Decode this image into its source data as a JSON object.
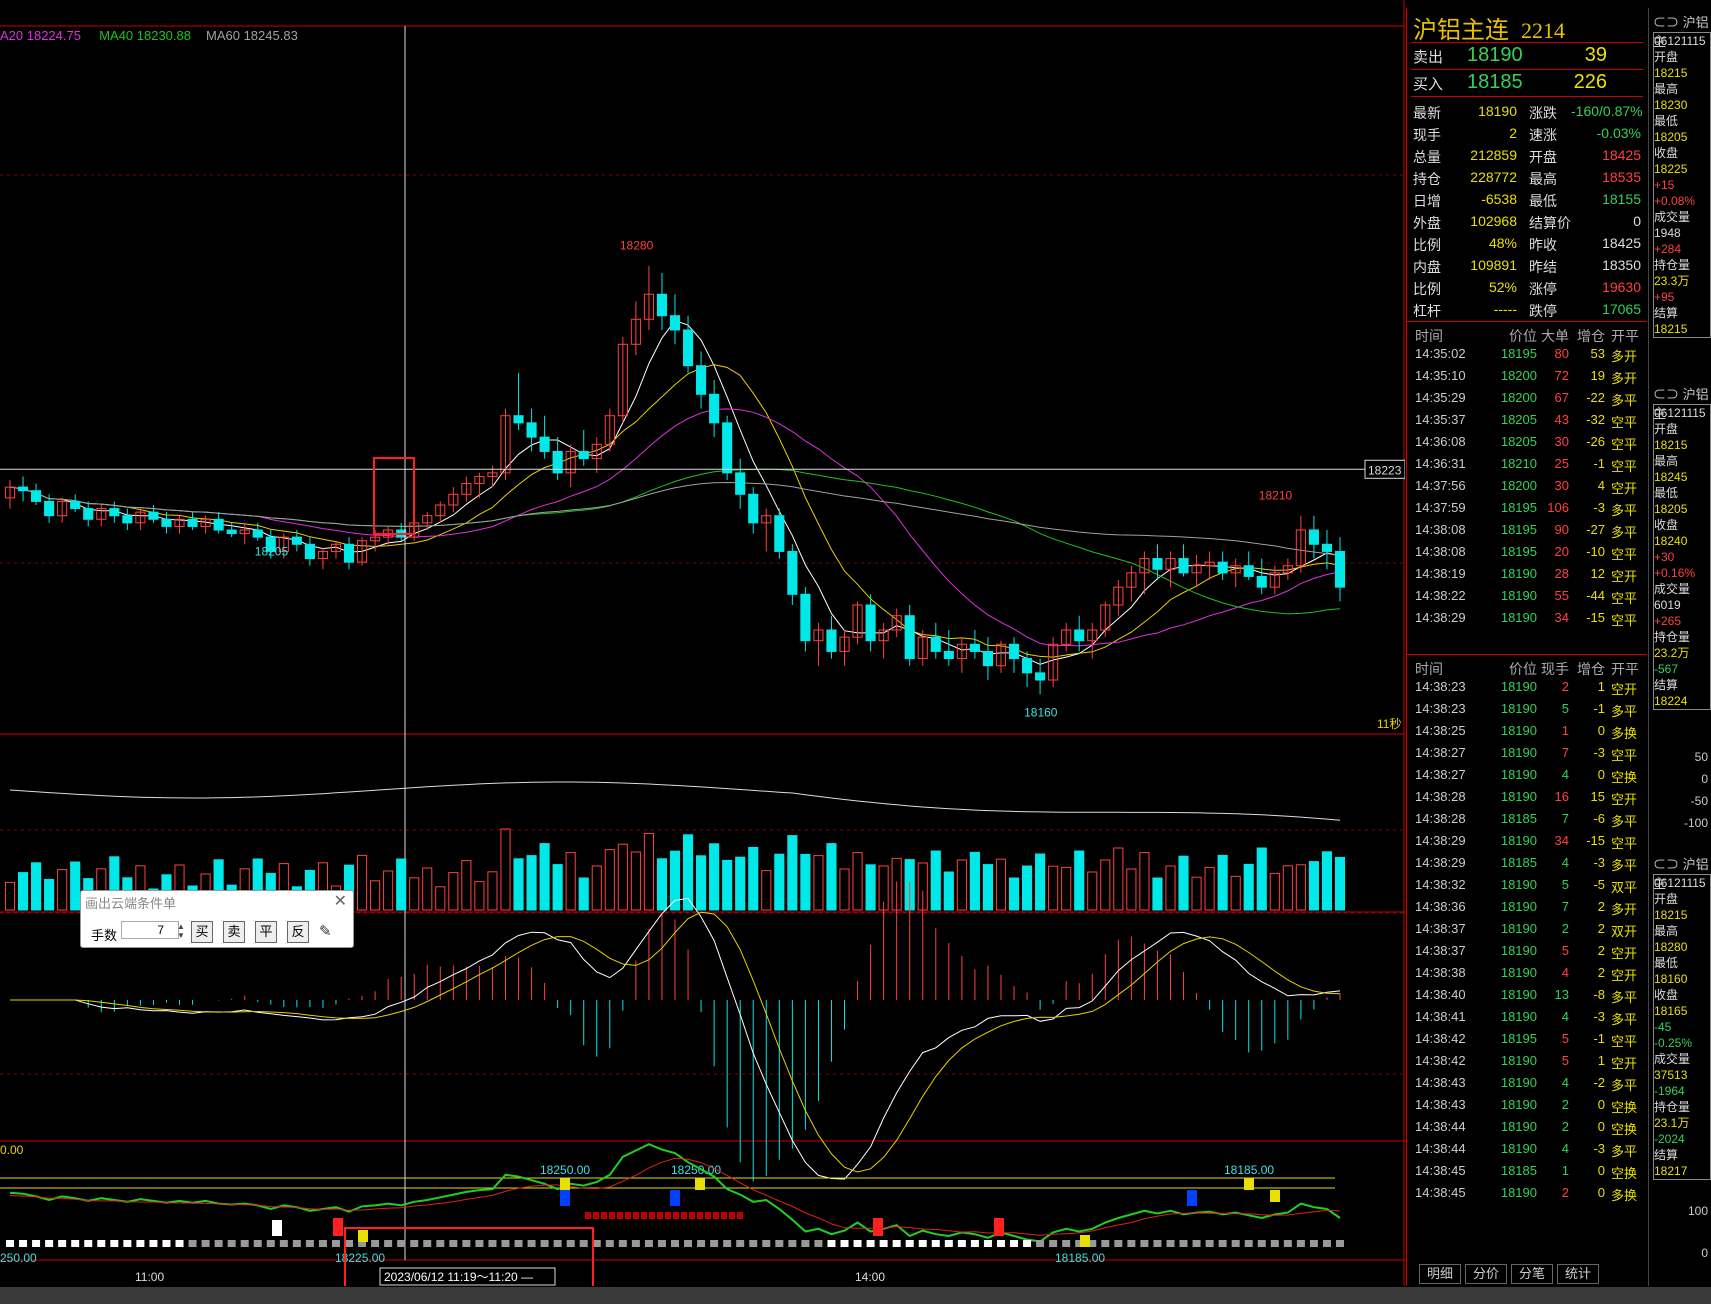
{
  "chart_data": {
    "type": "candlestick",
    "ma_legend": [
      {
        "text": "A20 18224.75",
        "color": "#e030e0"
      },
      {
        "text": "MA40 18230.88",
        "color": "#20c020"
      },
      {
        "text": "MA60 18245.83",
        "color": "#a0a0a0"
      }
    ],
    "price_annotations": [
      {
        "label": "18280",
        "color": "#ff4040"
      },
      {
        "label": "18205",
        "color": "#40e0e0"
      },
      {
        "label": "18210",
        "color": "#ff4040"
      },
      {
        "label": "18160",
        "color": "#40e0e0"
      }
    ],
    "crosshair_price": "18223",
    "countdown": "11秒",
    "indicator_labels": {
      "lower_left": "0.00",
      "level_labels": [
        "18250.00",
        "18250.00",
        "18185.00"
      ],
      "bottom_labels": [
        "250.00",
        "18225.00",
        "18185.00"
      ]
    },
    "x_ticks": [
      "11:00",
      "14:00"
    ],
    "crosshair_time": "2023/06/12 11:19～11:20 —",
    "candles": [
      [
        18215,
        18220,
        18212,
        18218
      ],
      [
        18218,
        18221,
        18214,
        18217
      ],
      [
        18217,
        18219,
        18213,
        18214
      ],
      [
        18214,
        18216,
        18208,
        18210
      ],
      [
        18210,
        18215,
        18208,
        18214
      ],
      [
        18214,
        18216,
        18211,
        18212
      ],
      [
        18212,
        18214,
        18207,
        18209
      ],
      [
        18209,
        18213,
        18207,
        18212
      ],
      [
        18212,
        18214,
        18208,
        18210
      ],
      [
        18210,
        18212,
        18206,
        18208
      ],
      [
        18208,
        18212,
        18206,
        18211
      ],
      [
        18211,
        18213,
        18208,
        18209
      ],
      [
        18209,
        18211,
        18205,
        18207
      ],
      [
        18207,
        18210,
        18205,
        18209
      ],
      [
        18209,
        18211,
        18206,
        18207
      ],
      [
        18207,
        18210,
        18205,
        18209
      ],
      [
        18209,
        18211,
        18205,
        18206
      ],
      [
        18206,
        18208,
        18204,
        18205
      ],
      [
        18205,
        18208,
        18202,
        18206
      ],
      [
        18206,
        18208,
        18203,
        18204
      ],
      [
        18204,
        18206,
        18198,
        18200
      ],
      [
        18200,
        18205,
        18198,
        18204
      ],
      [
        18204,
        18206,
        18200,
        18202
      ],
      [
        18202,
        18204,
        18196,
        18198
      ],
      [
        18198,
        18201,
        18195,
        18200
      ],
      [
        18200,
        18203,
        18198,
        18202
      ],
      [
        18202,
        18204,
        18195,
        18197
      ],
      [
        18197,
        18204,
        18196,
        18203
      ],
      [
        18203,
        18206,
        18200,
        18204
      ],
      [
        18204,
        18207,
        18202,
        18206
      ],
      [
        18206,
        18208,
        18203,
        18204
      ],
      [
        18204,
        18209,
        18203,
        18208
      ],
      [
        18208,
        18211,
        18206,
        18210
      ],
      [
        18210,
        18214,
        18208,
        18213
      ],
      [
        18213,
        18218,
        18211,
        18216
      ],
      [
        18216,
        18221,
        18214,
        18219
      ],
      [
        18219,
        18222,
        18215,
        18221
      ],
      [
        18221,
        18224,
        18218,
        18222
      ],
      [
        18222,
        18240,
        18220,
        18238
      ],
      [
        18238,
        18250,
        18234,
        18236
      ],
      [
        18236,
        18240,
        18228,
        18232
      ],
      [
        18232,
        18238,
        18226,
        18228
      ],
      [
        18228,
        18232,
        18220,
        18222
      ],
      [
        18222,
        18230,
        18218,
        18228
      ],
      [
        18228,
        18234,
        18224,
        18226
      ],
      [
        18226,
        18232,
        18222,
        18230
      ],
      [
        18230,
        18240,
        18228,
        18238
      ],
      [
        18238,
        18260,
        18236,
        18258
      ],
      [
        18258,
        18270,
        18255,
        18265
      ],
      [
        18265,
        18280,
        18262,
        18272
      ],
      [
        18272,
        18278,
        18262,
        18266
      ],
      [
        18266,
        18272,
        18258,
        18262
      ],
      [
        18262,
        18266,
        18250,
        18252
      ],
      [
        18252,
        18256,
        18240,
        18244
      ],
      [
        18244,
        18248,
        18232,
        18236
      ],
      [
        18236,
        18238,
        18220,
        18222
      ],
      [
        18222,
        18226,
        18212,
        18216
      ],
      [
        18216,
        18218,
        18205,
        18208
      ],
      [
        18208,
        18212,
        18200,
        18210
      ],
      [
        18210,
        18212,
        18198,
        18200
      ],
      [
        18200,
        18202,
        18185,
        18188
      ],
      [
        18188,
        18190,
        18172,
        18175
      ],
      [
        18175,
        18180,
        18168,
        18178
      ],
      [
        18178,
        18182,
        18170,
        18172
      ],
      [
        18172,
        18178,
        18168,
        18176
      ],
      [
        18176,
        18186,
        18174,
        18185
      ],
      [
        18185,
        18188,
        18172,
        18175
      ],
      [
        18175,
        18180,
        18170,
        18178
      ],
      [
        18178,
        18184,
        18176,
        18182
      ],
      [
        18182,
        18185,
        18168,
        18170
      ],
      [
        18170,
        18178,
        18168,
        18176
      ],
      [
        18176,
        18180,
        18170,
        18172
      ],
      [
        18172,
        18178,
        18168,
        18170
      ],
      [
        18170,
        18176,
        18166,
        18174
      ],
      [
        18174,
        18178,
        18170,
        18172
      ],
      [
        18172,
        18176,
        18164,
        18168
      ],
      [
        18168,
        18175,
        18166,
        18174
      ],
      [
        18174,
        18176,
        18166,
        18170
      ],
      [
        18170,
        18172,
        18162,
        18166
      ],
      [
        18166,
        18170,
        18160,
        18164
      ],
      [
        18164,
        18176,
        18162,
        18174
      ],
      [
        18174,
        18180,
        18172,
        18178
      ],
      [
        18178,
        18182,
        18172,
        18175
      ],
      [
        18175,
        18180,
        18170,
        18178
      ],
      [
        18178,
        18186,
        18176,
        18185
      ],
      [
        18185,
        18192,
        18182,
        18190
      ],
      [
        18190,
        18196,
        18186,
        18194
      ],
      [
        18194,
        18200,
        18188,
        18198
      ],
      [
        18198,
        18202,
        18192,
        18195
      ],
      [
        18195,
        18200,
        18190,
        18198
      ],
      [
        18198,
        18202,
        18193,
        18194
      ],
      [
        18194,
        18199,
        18190,
        18196
      ],
      [
        18196,
        18200,
        18192,
        18197
      ],
      [
        18197,
        18200,
        18192,
        18194
      ],
      [
        18194,
        18198,
        18190,
        18196
      ],
      [
        18196,
        18200,
        18192,
        18193
      ],
      [
        18193,
        18198,
        18188,
        18190
      ],
      [
        18190,
        18196,
        18188,
        18194
      ],
      [
        18194,
        18198,
        18192,
        18196
      ],
      [
        18196,
        18210,
        18194,
        18206
      ],
      [
        18206,
        18210,
        18198,
        18202
      ],
      [
        18202,
        18206,
        18195,
        18200
      ],
      [
        18200,
        18204,
        18186,
        18190
      ]
    ]
  },
  "quote": {
    "title": "沪铝主连",
    "code": "2214",
    "sell_label": "卖出",
    "sell_price": "18190",
    "sell_qty": "39",
    "buy_label": "买入",
    "buy_price": "18185",
    "buy_qty": "226",
    "stats": [
      {
        "l1": "最新",
        "v1": "18190",
        "c1": "#e8e000",
        "l2": "涨跌",
        "v2": "-160/0.87%",
        "c2": "#33d25a"
      },
      {
        "l1": "现手",
        "v1": "2",
        "c1": "#e8e000",
        "l2": "速涨",
        "v2": "-0.03%",
        "c2": "#33d25a"
      },
      {
        "l1": "总量",
        "v1": "212859",
        "c1": "#e8e000",
        "l2": "开盘",
        "v2": "18425",
        "c2": "#ff4040"
      },
      {
        "l1": "持仓",
        "v1": "228772",
        "c1": "#e8e000",
        "l2": "最高",
        "v2": "18535",
        "c2": "#ff4040"
      },
      {
        "l1": "日增",
        "v1": "-6538",
        "c1": "#e8e000",
        "l2": "最低",
        "v2": "18155",
        "c2": "#33d25a"
      },
      {
        "l1": "外盘",
        "v1": "102968",
        "c1": "#e8e000",
        "l2": "结算价",
        "v2": "0",
        "c2": "#dddddd"
      },
      {
        "l1": "比例",
        "v1": "48%",
        "c1": "#e8e000",
        "l2": "昨收",
        "v2": "18425",
        "c2": "#dddddd"
      },
      {
        "l1": "内盘",
        "v1": "109891",
        "c1": "#e8e000",
        "l2": "昨结",
        "v2": "18350",
        "c2": "#dddddd"
      },
      {
        "l1": "比例",
        "v1": "52%",
        "c1": "#e8e000",
        "l2": "涨停",
        "v2": "19630",
        "c2": "#ff4040"
      },
      {
        "l1": "杠杆",
        "v1": "-----",
        "c1": "#e8e000",
        "l2": "跌停",
        "v2": "17065",
        "c2": "#33d25a"
      }
    ],
    "big_head": [
      "时间",
      "价位",
      "大单",
      "增仓",
      "开平"
    ],
    "big_rows": [
      [
        "14:35:02",
        "18195",
        "80",
        "53",
        "多开"
      ],
      [
        "14:35:10",
        "18200",
        "72",
        "19",
        "多开"
      ],
      [
        "14:35:29",
        "18200",
        "67",
        "-22",
        "多平"
      ],
      [
        "14:35:37",
        "18205",
        "43",
        "-32",
        "空平"
      ],
      [
        "14:36:08",
        "18205",
        "30",
        "-26",
        "空平"
      ],
      [
        "14:36:31",
        "18210",
        "25",
        "-1",
        "空平"
      ],
      [
        "14:37:56",
        "18200",
        "30",
        "4",
        "空开"
      ],
      [
        "14:37:59",
        "18195",
        "106",
        "-3",
        "多平"
      ],
      [
        "14:38:08",
        "18195",
        "90",
        "-27",
        "多平"
      ],
      [
        "14:38:08",
        "18195",
        "20",
        "-10",
        "空平"
      ],
      [
        "14:38:19",
        "18190",
        "28",
        "12",
        "空开"
      ],
      [
        "14:38:22",
        "18190",
        "55",
        "-44",
        "空平"
      ],
      [
        "14:38:29",
        "18190",
        "34",
        "-15",
        "空平"
      ]
    ],
    "tick_head": [
      "时间",
      "价位",
      "现手",
      "增仓",
      "开平"
    ],
    "tick_rows": [
      [
        "14:38:23",
        "18190",
        "2",
        "1",
        "空开"
      ],
      [
        "14:38:23",
        "18190",
        "5",
        "-1",
        "多平"
      ],
      [
        "14:38:25",
        "18190",
        "1",
        "0",
        "多换"
      ],
      [
        "14:38:27",
        "18190",
        "7",
        "-3",
        "空平"
      ],
      [
        "14:38:27",
        "18190",
        "4",
        "0",
        "空换"
      ],
      [
        "14:38:28",
        "18190",
        "16",
        "15",
        "空开"
      ],
      [
        "14:38:28",
        "18185",
        "7",
        "-6",
        "多平"
      ],
      [
        "14:38:29",
        "18190",
        "34",
        "-15",
        "空平"
      ],
      [
        "14:38:29",
        "18185",
        "4",
        "-3",
        "多平"
      ],
      [
        "14:38:32",
        "18190",
        "5",
        "-5",
        "双平"
      ],
      [
        "14:38:36",
        "18190",
        "7",
        "2",
        "多开"
      ],
      [
        "14:38:37",
        "18190",
        "2",
        "2",
        "双开"
      ],
      [
        "14:38:37",
        "18190",
        "5",
        "2",
        "空开"
      ],
      [
        "14:38:38",
        "18190",
        "4",
        "2",
        "空开"
      ],
      [
        "14:38:40",
        "18190",
        "13",
        "-8",
        "多平"
      ],
      [
        "14:38:41",
        "18190",
        "4",
        "-3",
        "多平"
      ],
      [
        "14:38:42",
        "18195",
        "5",
        "-1",
        "空平"
      ],
      [
        "14:38:42",
        "18190",
        "5",
        "1",
        "空开"
      ],
      [
        "14:38:43",
        "18190",
        "4",
        "-2",
        "多平"
      ],
      [
        "14:38:43",
        "18190",
        "2",
        "0",
        "空换"
      ],
      [
        "14:38:44",
        "18190",
        "2",
        "0",
        "空换"
      ],
      [
        "14:38:44",
        "18190",
        "4",
        "-3",
        "多平"
      ],
      [
        "14:38:45",
        "18185",
        "1",
        "0",
        "空换"
      ],
      [
        "14:38:45",
        "18190",
        "2",
        "0",
        "多换"
      ]
    ],
    "tabs": [
      "明细",
      "分价",
      "分笔",
      "统计"
    ]
  },
  "strip": {
    "head": "⊂⊃ 沪铝主",
    "blocks": [
      [
        "06121115",
        "开盘",
        "18215",
        "最高",
        "18230",
        "最低",
        "18205",
        "收盘",
        "18225",
        "+15",
        "+0.08%",
        "成交量",
        "1948",
        "+284",
        "持仓量",
        "23.3万",
        "+95",
        "结算",
        "18215"
      ],
      [
        "06121115",
        "开盘",
        "18215",
        "最高",
        "18245",
        "最低",
        "18205",
        "收盘",
        "18240",
        "+30",
        "+0.16%",
        "成交量",
        "6019",
        "+265",
        "持仓量",
        "23.2万",
        "-567",
        "结算",
        "18224"
      ],
      [
        "06121115",
        "开盘",
        "18215",
        "最高",
        "18280",
        "最低",
        "18160",
        "收盘",
        "18165",
        "-45",
        "-0.25%",
        "成交量",
        "37513",
        "-1964",
        "持仓量",
        "23.1万",
        "-2024",
        "结算",
        "18217"
      ]
    ],
    "axis": [
      "50",
      "0",
      "-50",
      "-100"
    ],
    "axis2": [
      "100",
      "0",
      "-100"
    ]
  },
  "order": {
    "title": "画出云端条件单",
    "qty_label": "手数",
    "qty_value": "7",
    "buttons": [
      "买",
      "卖",
      "平",
      "反"
    ],
    "pen_icon": "pen-icon"
  },
  "colors": {
    "up": "#ff4040",
    "down": "#00e8e8",
    "green": "#33d25a",
    "yellow": "#e8e000"
  }
}
